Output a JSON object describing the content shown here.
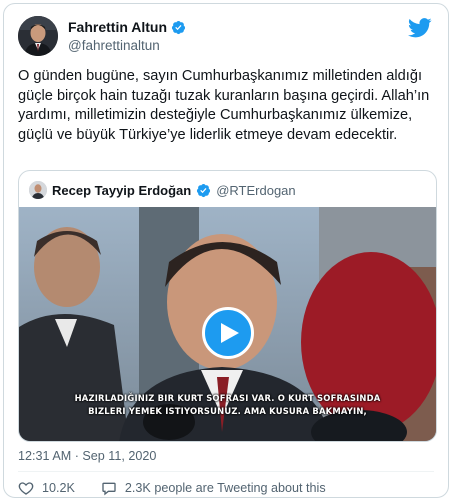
{
  "author": {
    "display_name": "Fahrettin Altun",
    "handle": "@fahrettinaltun",
    "verified_icon": "verified-badge-icon",
    "avatar_icon": "avatar"
  },
  "platform_icon": "twitter-bird-icon",
  "tweet": {
    "text": "O günden bugüne, sayın Cumhurbaşkanımız milletinden aldığı güçle birçok hain tuzağı tuzak kuranların başına geçirdi. Allah’ın yardımı, milletimizin desteğiyle Cumhurbaşkanımız ülkemize, güçlü ve büyük Türkiye’ye liderlik etmeye devam edecektir."
  },
  "quoted_tweet": {
    "display_name": "Recep Tayyip Erdoğan",
    "handle": "@RTErdogan",
    "video": {
      "subtitle_line1": "HAZIRLADIĞINIZ BIR KURT SOFRASI VAR. O KURT SOFRASINDA",
      "subtitle_line2": "BIZLERI YEMEK ISTIYORSUNUZ. AMA KUSURA BAKMAYIN,",
      "play_icon": "play-icon"
    }
  },
  "timestamp": "12:31 AM · Sep 11, 2020",
  "actions": {
    "likes": "10.2K",
    "reply_text": "2.3K people are Tweeting about this"
  },
  "colors": {
    "accent": "#1d9bf0",
    "text_primary": "#0f1419",
    "text_secondary": "#536471",
    "border": "#cfd9de"
  }
}
